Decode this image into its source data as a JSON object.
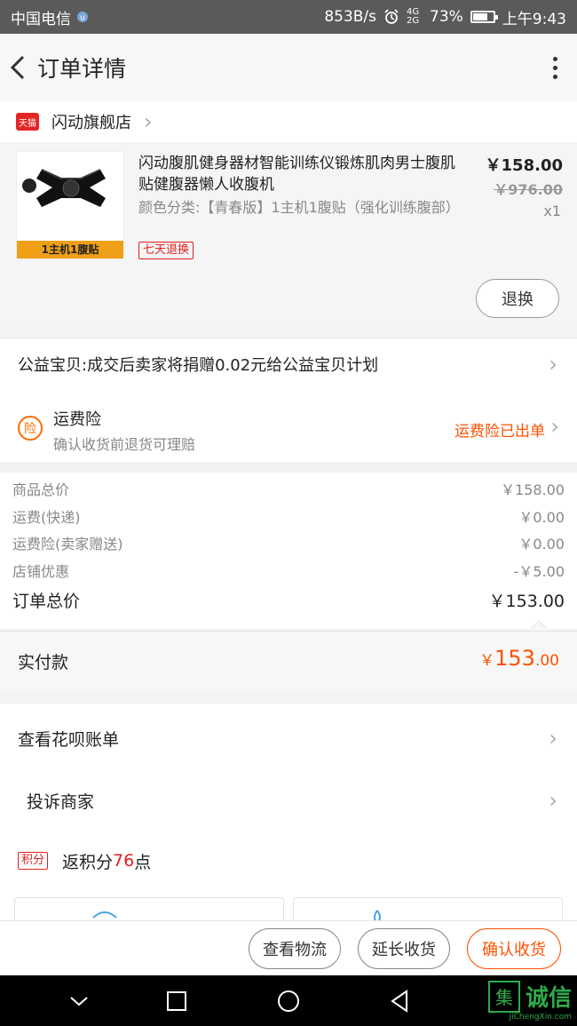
{
  "status_bar": {
    "carrier": "中国电信",
    "speed": "853B/s",
    "network": "4G 2G",
    "battery": "73%",
    "battery_level": 0.73,
    "time": "上午9:43"
  },
  "header": {
    "title": "订单详情"
  },
  "shop": {
    "platform_tag": "天猫",
    "name": "闪动旗舰店"
  },
  "item": {
    "image_band": "1主机1腹贴",
    "title": "闪动腹肌健身器材智能训练仪锻炼肌肉男士腹肌贴健腹器懒人收腹机",
    "spec": "颜色分类:【青春版】1主机1腹贴（强化训练腹部）",
    "badge": "七天退换",
    "price": "￥158.00",
    "original_price": "￥976.00",
    "qty": "x1",
    "return_button": "退换"
  },
  "charity": {
    "text": "公益宝贝:成交后卖家将捐赠0.02元给公益宝贝计划"
  },
  "insurance": {
    "icon_text": "险",
    "title": "运费险",
    "subtitle": "确认收货前退货可理赔",
    "status": "运费险已出单"
  },
  "summary": {
    "rows": [
      {
        "label": "商品总价",
        "value": "￥158.00"
      },
      {
        "label": "运费(快递)",
        "value": "￥0.00"
      },
      {
        "label": "运费险(卖家赠送)",
        "value": "￥0.00"
      },
      {
        "label": "店铺优惠",
        "value": "-￥5.00"
      }
    ],
    "total_label": "订单总价",
    "total_value": "￥153.00"
  },
  "paid": {
    "label": "实付款",
    "currency": "￥",
    "integer": "153",
    "decimal": ".00"
  },
  "menu": {
    "huabei": "查看花呗账单",
    "complain": "投诉商家",
    "points_tag": "积分",
    "points_prefix": "返积分",
    "points_num": "76",
    "points_suffix": "点"
  },
  "bottom_bar": {
    "logistics": "查看物流",
    "extend": "延长收货",
    "confirm": "确认收货"
  },
  "watermark": {
    "glyph": "集",
    "text": "诚信",
    "sub": "JiChengXin.com"
  },
  "colors": {
    "accent": "#ff5000",
    "red": "#e02020",
    "watermark": "#2eaa4a"
  }
}
